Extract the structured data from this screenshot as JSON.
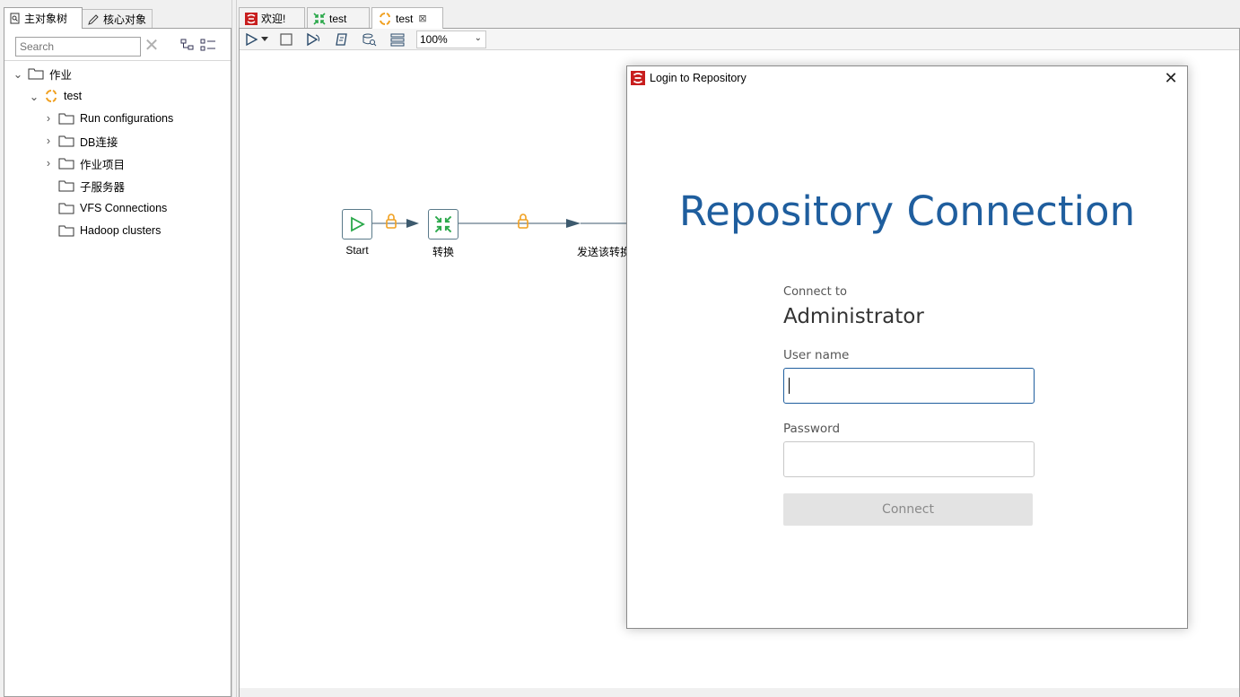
{
  "left_panel": {
    "tabs": [
      {
        "label": "主对象树",
        "icon": "object-tree-icon"
      },
      {
        "label": "核心对象",
        "icon": "pencil-icon"
      }
    ],
    "search": {
      "placeholder": "Search"
    },
    "tree": [
      {
        "label": "作业",
        "level": 0,
        "expanded": true,
        "icon": "folder-icon"
      },
      {
        "label": "test",
        "level": 1,
        "expanded": true,
        "icon": "job-icon"
      },
      {
        "label": "Run configurations",
        "level": 2,
        "expandable": true,
        "icon": "folder-icon"
      },
      {
        "label": "DB连接",
        "level": 2,
        "expandable": true,
        "icon": "folder-icon"
      },
      {
        "label": "作业项目",
        "level": 2,
        "expandable": true,
        "icon": "folder-icon"
      },
      {
        "label": "子服务器",
        "level": 2,
        "expandable": false,
        "icon": "folder-icon"
      },
      {
        "label": "VFS Connections",
        "level": 2,
        "expandable": false,
        "icon": "folder-icon"
      },
      {
        "label": "Hadoop clusters",
        "level": 2,
        "expandable": false,
        "icon": "folder-icon"
      }
    ]
  },
  "editor": {
    "tabs": [
      {
        "label": "欢迎!",
        "icon": "spoon-icon"
      },
      {
        "label": "test",
        "icon": "transformation-icon"
      },
      {
        "label": "test",
        "icon": "job-icon",
        "active": true
      }
    ],
    "zoom": "100%",
    "canvas": {
      "nodes": [
        {
          "label": "Start",
          "icon": "start-play-icon"
        },
        {
          "label": "转换",
          "icon": "transformation-icon"
        },
        {
          "label": "发送该转换"
        }
      ]
    }
  },
  "dialog": {
    "title": "Login to Repository",
    "heading": "Repository Connection",
    "connect_to_label": "Connect to",
    "connect_to_value": "Administrator",
    "username_label": "User name",
    "username_value": "",
    "password_label": "Password",
    "password_value": "",
    "connect_button": "Connect"
  },
  "colors": {
    "accent": "#1f5e9e",
    "lock": "#f0a020",
    "node_green": "#2aa84a"
  }
}
